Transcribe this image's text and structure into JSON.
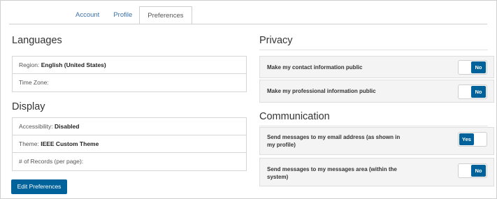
{
  "tabs": [
    {
      "label": "Account",
      "active": false
    },
    {
      "label": "Profile",
      "active": false
    },
    {
      "label": "Preferences",
      "active": true
    }
  ],
  "languages": {
    "heading": "Languages",
    "region_label": "Region:",
    "region_value": "English (United States)",
    "timezone_label": "Time Zone:",
    "timezone_value": ""
  },
  "display": {
    "heading": "Display",
    "accessibility_label": "Accessibility:",
    "accessibility_value": "Disabled",
    "theme_label": "Theme:",
    "theme_value": "IEEE Custom Theme",
    "records_label": "# of Records (per page):",
    "records_value": ""
  },
  "edit_button": "Edit Preferences",
  "privacy": {
    "heading": "Privacy",
    "items": [
      {
        "label": "Make my contact information public",
        "value": "No"
      },
      {
        "label": "Make my professional information public",
        "value": "No"
      }
    ]
  },
  "communication": {
    "heading": "Communication",
    "items": [
      {
        "label_line1": "Send messages to my email address (as shown in",
        "label_line2": "my profile)",
        "value": "Yes"
      },
      {
        "label_line1": "Send messages to my messages area (within the",
        "label_line2": "system)",
        "value": "No"
      }
    ]
  },
  "colors": {
    "accent": "#00629b",
    "link": "#3b6fa8"
  }
}
